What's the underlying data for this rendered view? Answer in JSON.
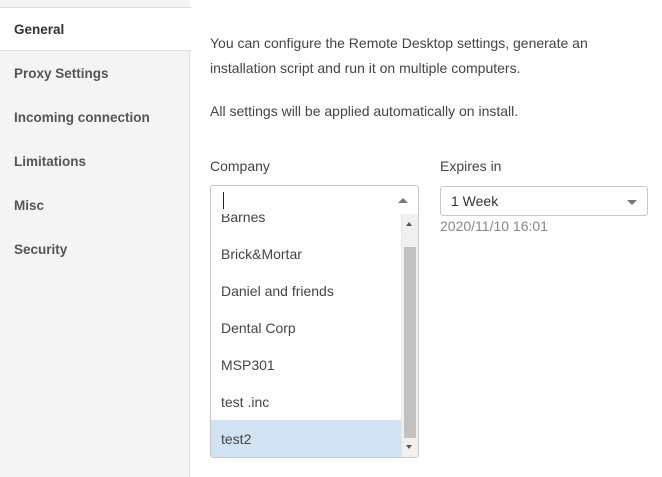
{
  "sidebar": {
    "items": [
      {
        "label": "General",
        "active": true
      },
      {
        "label": "Proxy Settings",
        "active": false
      },
      {
        "label": "Incoming connection",
        "active": false
      },
      {
        "label": "Limitations",
        "active": false
      },
      {
        "label": "Misc",
        "active": false
      },
      {
        "label": "Security",
        "active": false
      }
    ]
  },
  "main": {
    "description": "You can configure the Remote Desktop settings, generate an installation script and run it on multiple computers.",
    "note": "All settings will be applied automatically on install.",
    "company": {
      "label": "Company",
      "value": "",
      "options": [
        "Barnes",
        "Brick&Mortar",
        "Daniel and friends",
        "Dental Corp",
        "MSP301",
        "test .inc",
        "test2"
      ],
      "highlighted": "test2"
    },
    "expires": {
      "label": "Expires in",
      "value": "1 Week",
      "date": "2020/11/10 16:01"
    }
  },
  "colors": {
    "sidebar_bg": "#f4f4f4",
    "highlight": "#d3e2f2",
    "border": "#c8c8c8"
  }
}
